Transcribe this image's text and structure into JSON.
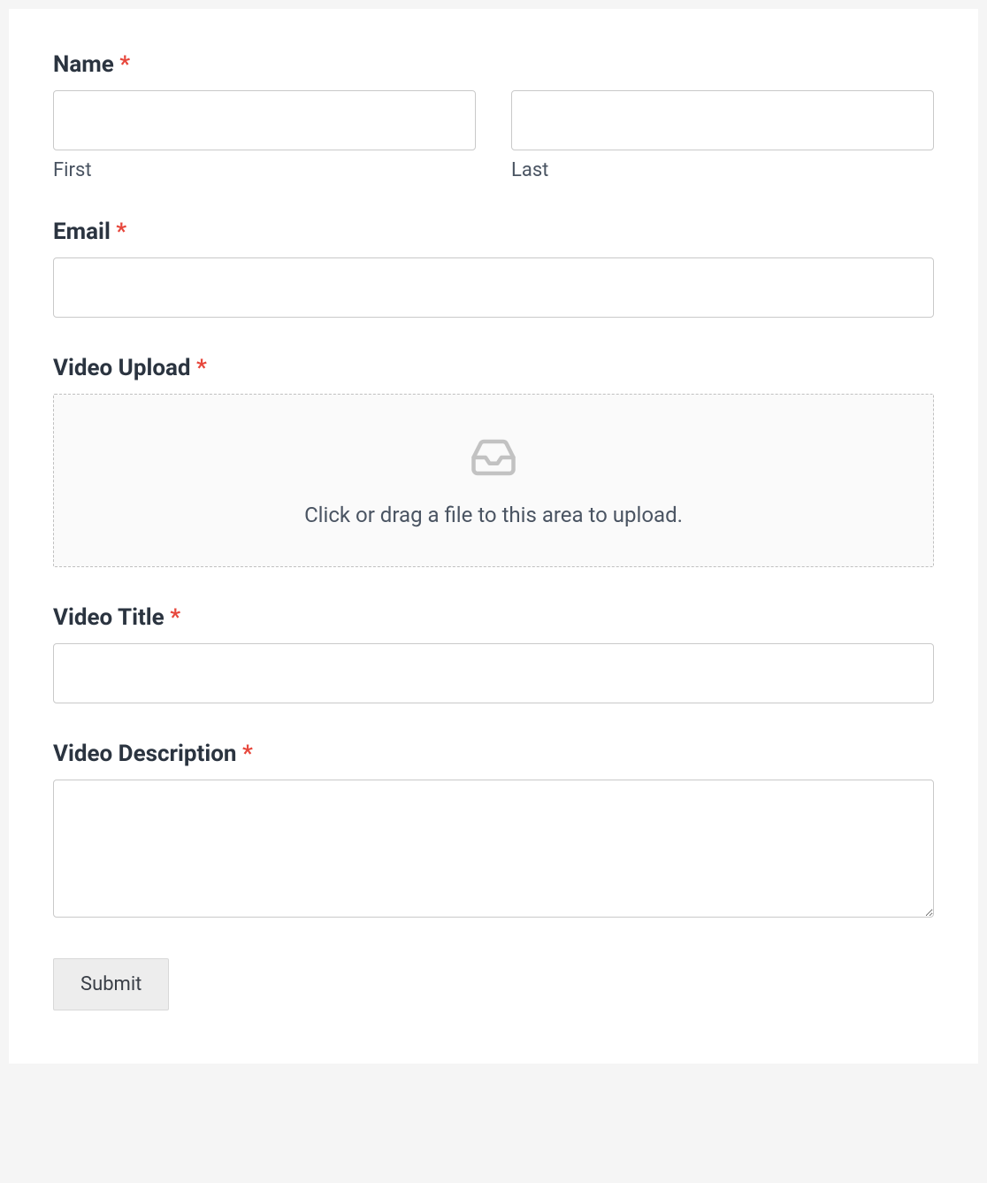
{
  "form": {
    "name": {
      "label": "Name",
      "required": "*",
      "first_sublabel": "First",
      "last_sublabel": "Last",
      "first_value": "",
      "last_value": ""
    },
    "email": {
      "label": "Email",
      "required": "*",
      "value": ""
    },
    "video_upload": {
      "label": "Video Upload",
      "required": "*",
      "dropzone_text": "Click or drag a file to this area to upload."
    },
    "video_title": {
      "label": "Video Title",
      "required": "*",
      "value": ""
    },
    "video_description": {
      "label": "Video Description",
      "required": "*",
      "value": ""
    },
    "submit_label": "Submit"
  }
}
